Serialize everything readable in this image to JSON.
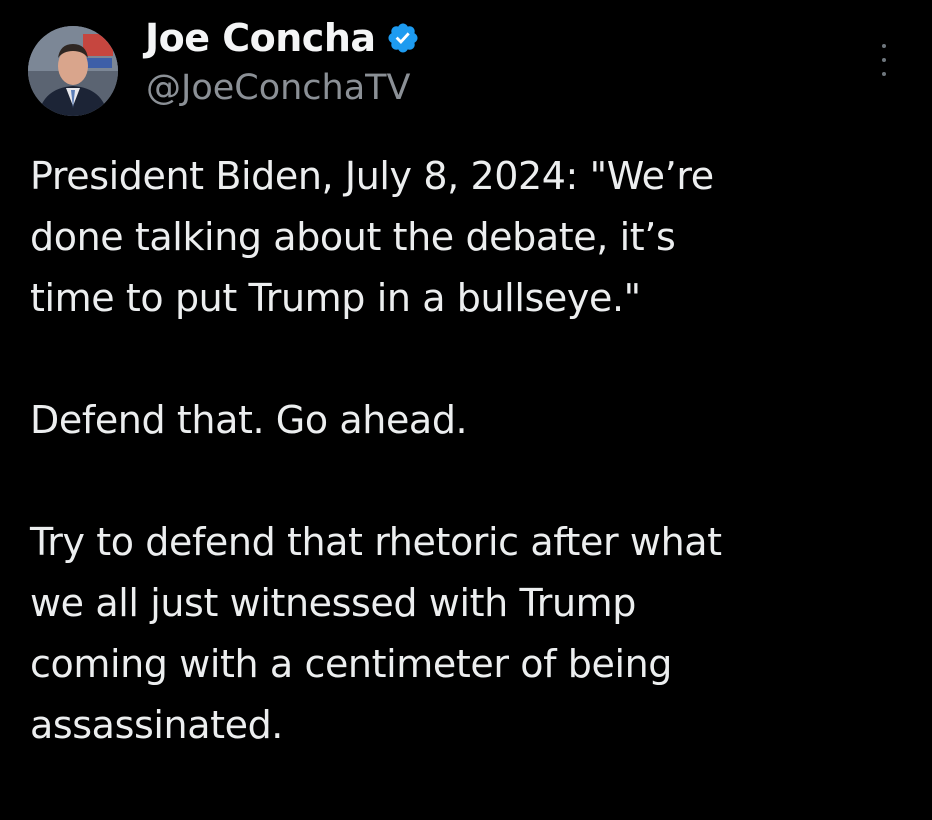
{
  "author": {
    "display_name": "Joe Concha",
    "handle": "@JoeConchaTV",
    "verified": true,
    "verified_color": "#1d9bf0",
    "avatar_icon": "avatar-photo"
  },
  "menu": {
    "icon": "more-vertical-icon"
  },
  "tweet": {
    "paragraphs": [
      [
        "President Biden, July 8, 2024: \"We’re",
        "done talking about the debate, it’s",
        "time to put Trump in a bullseye.\""
      ],
      [
        "Defend that. Go ahead."
      ],
      [
        "Try to defend that rhetoric after what",
        "we all just witnessed with Trump",
        "coming with a centimeter of being",
        "assassinated."
      ]
    ]
  },
  "colors": {
    "background": "#000000",
    "text": "#e7e9ea",
    "secondary_text": "#8b9096"
  }
}
